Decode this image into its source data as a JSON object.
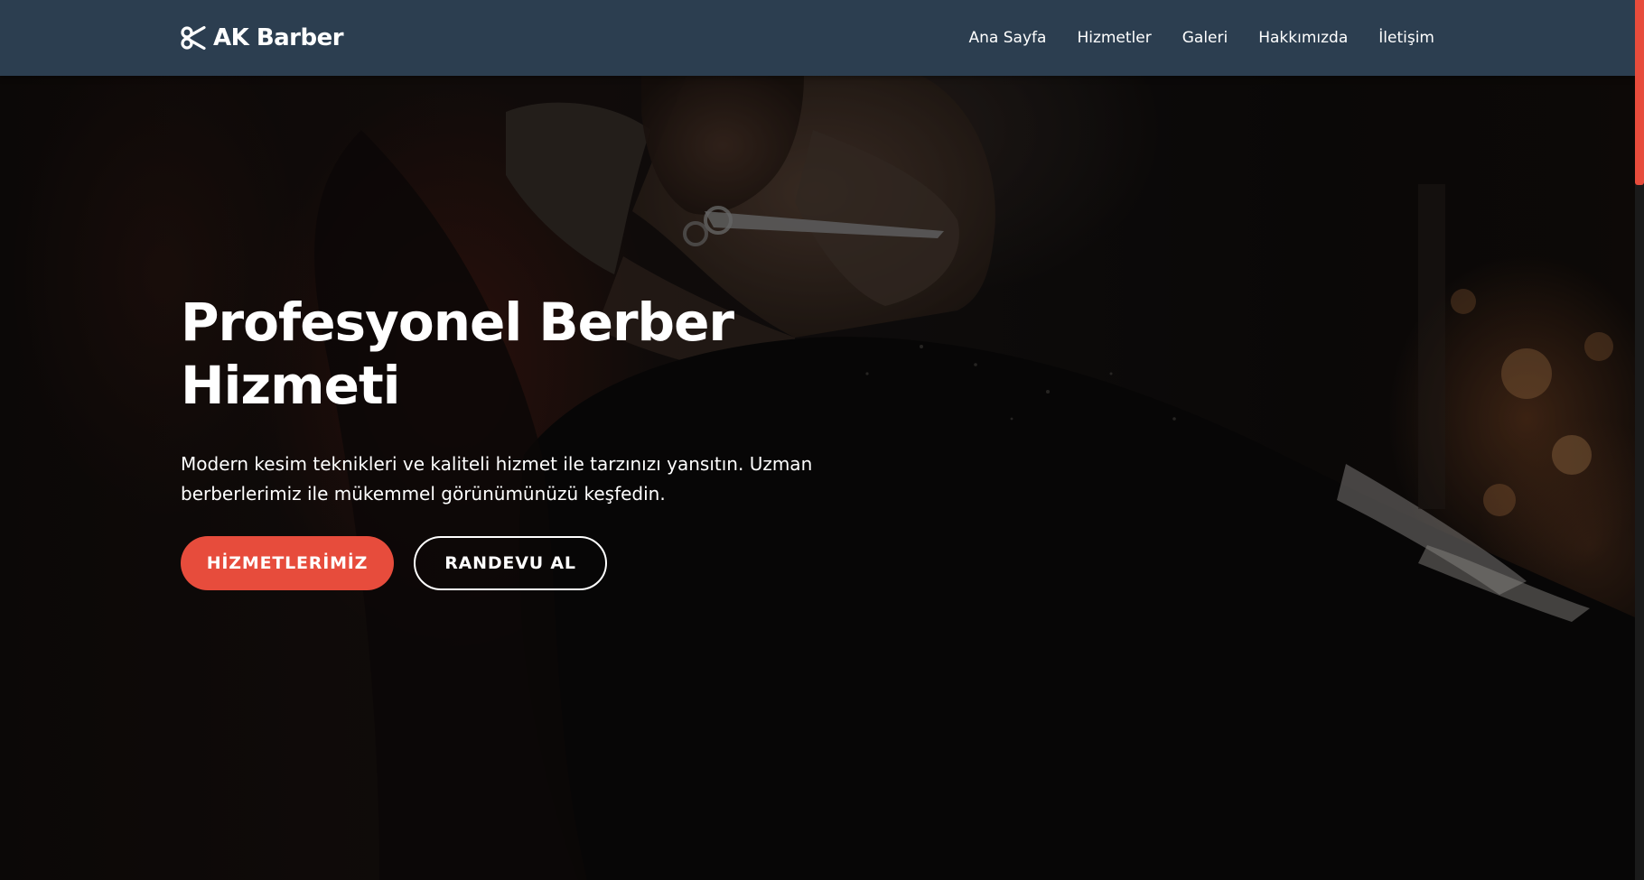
{
  "brand": {
    "name": "AK Barber",
    "icon": "scissors-icon",
    "accent_color": "#e74c3c",
    "navbar_color": "#2c3e50"
  },
  "nav": {
    "links": [
      {
        "label": "Ana Sayfa"
      },
      {
        "label": "Hizmetler"
      },
      {
        "label": "Galeri"
      },
      {
        "label": "Hakkımızda"
      },
      {
        "label": "İletişim"
      }
    ]
  },
  "hero": {
    "title": "Profesyonel Berber Hizmeti",
    "text": "Modern kesim teknikleri ve kaliteli hizmet ile tarzınızı yansıtın. Uzman berberlerimiz ile mükemmel görünümünüzü keşfedin.",
    "primary_button": "HİZMETLERİMİZ",
    "secondary_button": "RANDEVU AL"
  }
}
